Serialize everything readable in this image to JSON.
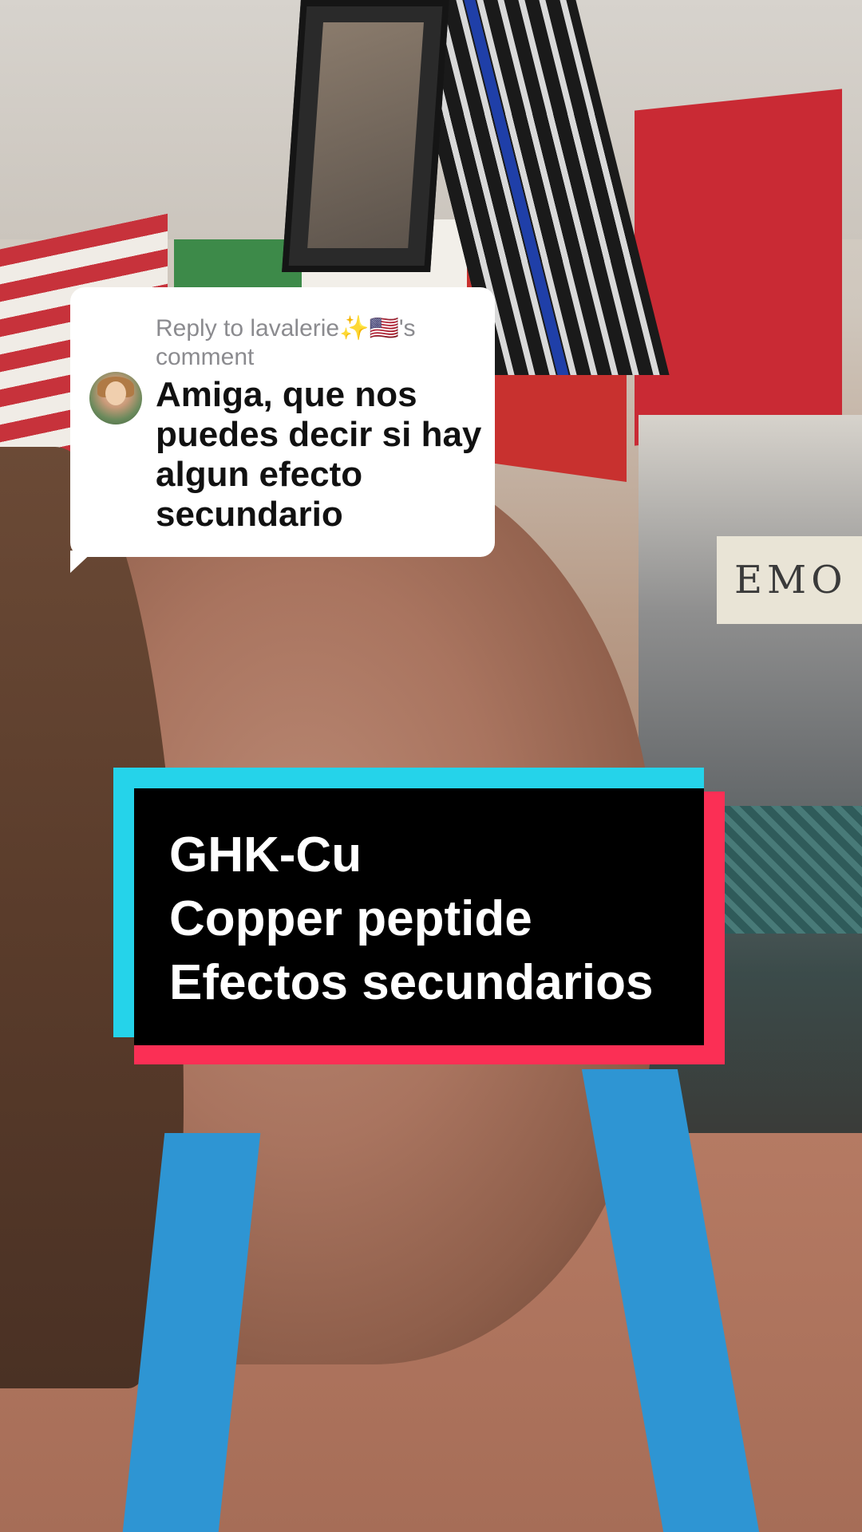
{
  "reply_comment": {
    "header": "Reply to lavalerie✨🇺🇸's comment",
    "body": "Amiga, que nos puedes decir si hay algun efecto secundario"
  },
  "background": {
    "sign_text": "EMO"
  },
  "title_overlay": {
    "lines": [
      "GHK-Cu",
      "Copper peptide",
      "Efectos secundarios"
    ]
  },
  "colors": {
    "overlay_cyan": "#25d3ea",
    "overlay_red": "#fb2f55",
    "overlay_black": "#000000",
    "card_white": "#ffffff"
  }
}
